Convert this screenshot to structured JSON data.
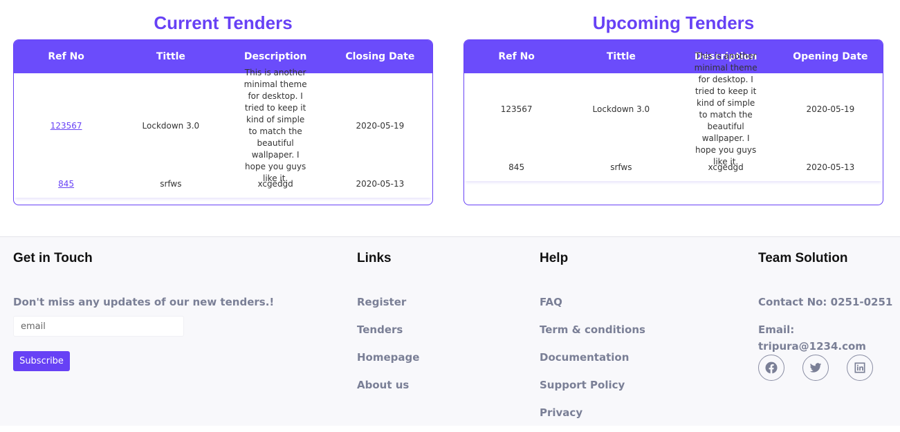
{
  "current": {
    "title": "Current Tenders",
    "headers": [
      "Ref No",
      "Tittle",
      "Description",
      "Closing Date"
    ],
    "rows": [
      {
        "ref": "123567",
        "title": "Lockdown 3.0",
        "desc": "This is another minimal theme for desktop. I tried to keep it kind of simple to match the beautiful wallpaper. I hope you guys like it.",
        "date": "2020-05-19"
      },
      {
        "ref": "845",
        "title": "srfws",
        "desc": "xcgedgd",
        "date": "2020-05-13"
      }
    ]
  },
  "upcoming": {
    "title": "Upcoming Tenders",
    "headers": [
      "Ref No",
      "Tittle",
      "Description",
      "Opening Date"
    ],
    "rows": [
      {
        "ref": "123567",
        "title": "Lockdown 3.0",
        "desc": "This is another minimal theme for desktop. I tried to keep it kind of simple to match the beautiful wallpaper. I hope you guys like it.",
        "date": "2020-05-19"
      },
      {
        "ref": "845",
        "title": "srfws",
        "desc": "xcgedgd",
        "date": "2020-05-13"
      }
    ]
  },
  "footer": {
    "touch": {
      "heading": "Get in Touch",
      "text": "Don't miss any updates of our new tenders.!",
      "email_placeholder": "email",
      "subscribe_label": "Subscribe"
    },
    "links": {
      "heading": "Links",
      "items": [
        "Register",
        "Tenders",
        "Homepage",
        "About us"
      ]
    },
    "help": {
      "heading": "Help",
      "items": [
        "FAQ",
        "Term & conditions",
        "Documentation",
        "Support Policy",
        "Privacy"
      ]
    },
    "team": {
      "heading": "Team Solution",
      "contact": "Contact No: 0251-0251",
      "email": "Email: tripura@1234.com",
      "socials": [
        "facebook-icon",
        "twitter-icon",
        "linkedin-icon"
      ]
    }
  },
  "colors": {
    "accent": "#6741f5",
    "muted": "#7a7f96"
  }
}
